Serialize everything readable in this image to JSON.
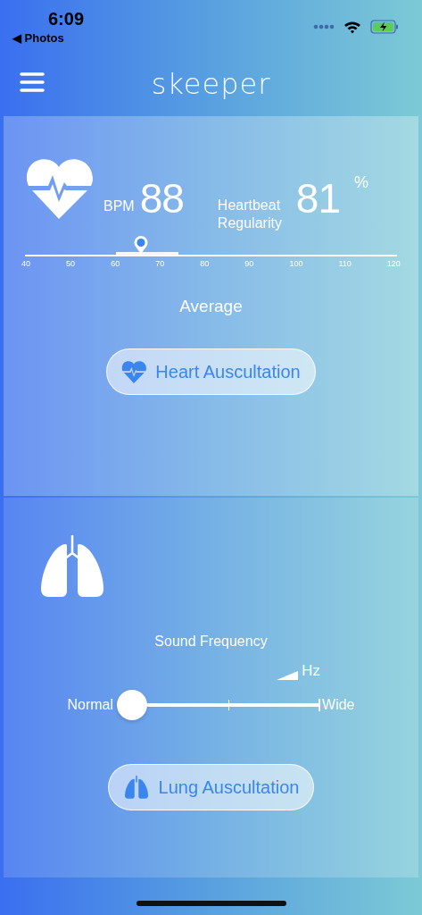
{
  "status_bar": {
    "time": "6:09",
    "back_link": "◀ Photos"
  },
  "header": {
    "logo": "skeeper"
  },
  "heart": {
    "bpm_label": "BPM",
    "bpm": "88",
    "regularity_label": "Heartbeat Regularity",
    "regularity": "81",
    "unit": "%",
    "scale": {
      "level": 0.3125,
      "ticks": [
        "40",
        "50",
        "60",
        "70",
        "80",
        "90",
        "100",
        "110",
        "120"
      ]
    },
    "caption": "Average",
    "button": "Heart Auscultation"
  },
  "lung": {
    "title": "Sound Frequency",
    "unit": "Hz",
    "slider": {
      "min_label": "Normal",
      "max_label": "Wide",
      "level": 0
    },
    "button": "Lung Auscultation"
  }
}
